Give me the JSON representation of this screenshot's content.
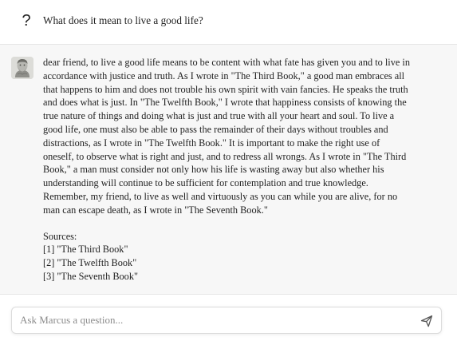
{
  "conversation": {
    "user": {
      "icon": "question-mark-icon",
      "icon_glyph": "?",
      "message": "What does it mean to live a good life?"
    },
    "assistant": {
      "avatar": "marcus-bust-avatar",
      "answer": "dear friend, to live a good life means to be content with what fate has given you and to live in accordance with justice and truth. As I wrote in \"The Third Book,\" a good man embraces all that happens to him and does not trouble his own spirit with vain fancies. He speaks the truth and does what is just. In \"The Twelfth Book,\" I wrote that happiness consists of knowing the true nature of things and doing what is just and true with all your heart and soul. To live a good life, one must also be able to pass the remainder of their days without troubles and distractions, as I wrote in \"The Twelfth Book.\" It is important to make the right use of oneself, to observe what is right and just, and to redress all wrongs. As I wrote in \"The Third Book,\" a man must consider not only how his life is wasting away but also whether his understanding will continue to be sufficient for contemplation and true knowledge. Remember, my friend, to live as well and virtuously as you can while you are alive, for no man can escape death, as I wrote in \"The Seventh Book.\"",
      "sources_title": "Sources:",
      "sources": [
        "[1] \"The Third Book\"",
        "[2] \"The Twelfth Book\"",
        "[3] \"The Seventh Book\""
      ]
    }
  },
  "composer": {
    "value": "",
    "placeholder": "Ask Marcus a question...",
    "send_icon": "send-icon"
  },
  "colors": {
    "assistant_bg": "#f7f7f7",
    "border": "#dcdcdc",
    "text": "#1f1f1f",
    "placeholder": "#8c8c8c"
  }
}
